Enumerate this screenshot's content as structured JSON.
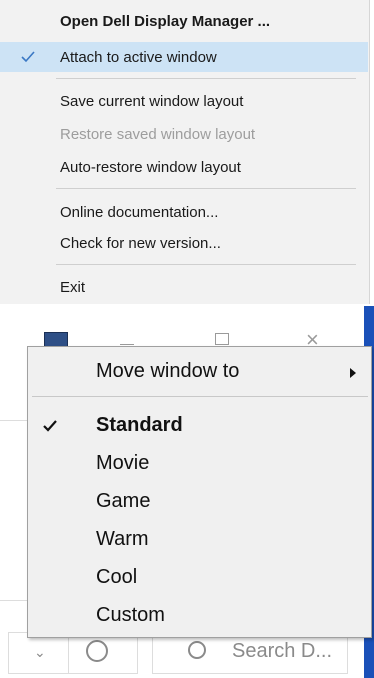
{
  "tray_menu": {
    "items": [
      {
        "label": "Open Dell Display Manager ...",
        "bold": true,
        "checked": false,
        "disabled": false,
        "highlighted": false
      },
      {
        "label": "Attach to active window",
        "bold": false,
        "checked": true,
        "disabled": false,
        "highlighted": true
      },
      {
        "label": "Save current window layout",
        "bold": false,
        "checked": false,
        "disabled": false,
        "highlighted": false
      },
      {
        "label": "Restore saved window layout",
        "bold": false,
        "checked": false,
        "disabled": true,
        "highlighted": false
      },
      {
        "label": "Auto-restore window layout",
        "bold": false,
        "checked": false,
        "disabled": false,
        "highlighted": false
      },
      {
        "label": "Online documentation...",
        "bold": false,
        "checked": false,
        "disabled": false,
        "highlighted": false
      },
      {
        "label": "Check for new version...",
        "bold": false,
        "checked": false,
        "disabled": false,
        "highlighted": false
      },
      {
        "label": "Exit",
        "bold": false,
        "checked": false,
        "disabled": false,
        "highlighted": false
      }
    ],
    "check_color": "#3a78c4"
  },
  "window": {
    "search_placeholder": "Search D...",
    "accent_edge_color": "#1a50b8"
  },
  "context_menu": {
    "move_label": "Move window to",
    "items": [
      {
        "label": "Standard",
        "checked": true,
        "bold": true
      },
      {
        "label": "Movie",
        "checked": false,
        "bold": false
      },
      {
        "label": "Game",
        "checked": false,
        "bold": false
      },
      {
        "label": "Warm",
        "checked": false,
        "bold": false
      },
      {
        "label": "Cool",
        "checked": false,
        "bold": false
      },
      {
        "label": "Custom",
        "checked": false,
        "bold": false
      }
    ]
  }
}
